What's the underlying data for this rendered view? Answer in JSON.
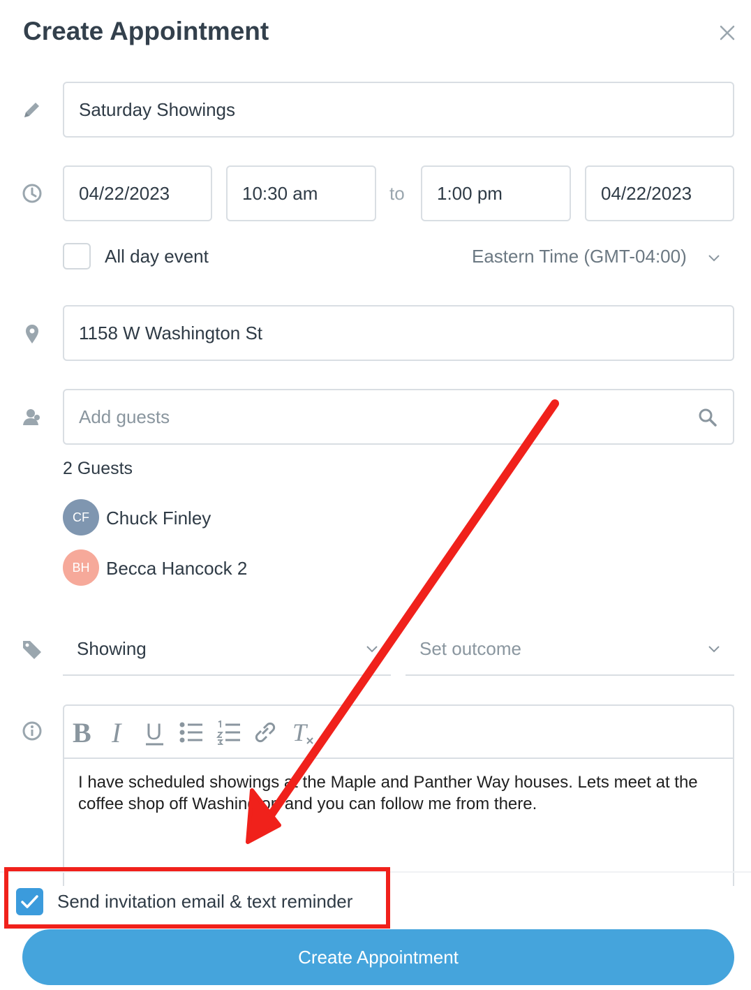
{
  "dialog": {
    "title": "Create Appointment",
    "close_icon": "close-icon"
  },
  "form": {
    "title_value": "Saturday Showings",
    "start_date": "04/22/2023",
    "start_time": "10:30 am",
    "to_label": "to",
    "end_time": "1:00 pm",
    "end_date": "04/22/2023",
    "all_day_label": "All day event",
    "all_day_checked": false,
    "timezone": "Eastern Time (GMT-04:00)",
    "location_value": "1158 W Washington St",
    "guests_placeholder": "Add guests",
    "guests_count": "2 Guests",
    "guests": [
      {
        "initials": "CF",
        "name": "Chuck Finley",
        "color": "#7f96b0"
      },
      {
        "initials": "BH",
        "name": "Becca Hancock 2",
        "color": "#f6a99a"
      }
    ],
    "type_value": "Showing",
    "outcome_placeholder": "Set outcome",
    "notes": "I have scheduled showings at the Maple and Panther Way houses. Lets meet at the coffee shop off Washington and you can follow me from there.",
    "toolbar_icons": [
      "bold-icon",
      "italic-icon",
      "underline-icon",
      "bullet-list-icon",
      "numbered-list-icon",
      "link-icon",
      "clear-format-icon"
    ],
    "toolbar_glyphs": {
      "bold": "B",
      "italic": "I",
      "underline": "U",
      "clear": "T"
    }
  },
  "footer": {
    "send_invite_label": "Send invitation email & text reminder",
    "send_invite_checked": true,
    "submit_label": "Create Appointment"
  },
  "colors": {
    "accent": "#45a4dc",
    "checkbox": "#3b9bdc",
    "annotation": "#f0211b"
  }
}
